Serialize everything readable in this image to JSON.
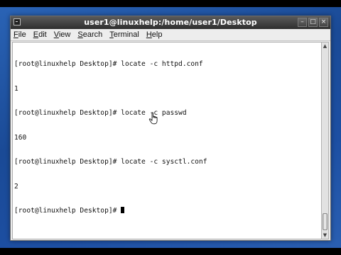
{
  "window": {
    "title": "user1@linuxhelp:/home/user1/Desktop",
    "buttons": {
      "minimize": "–",
      "maximize": "□",
      "close": "×"
    }
  },
  "menubar": {
    "items": [
      {
        "underline": "F",
        "rest": "ile"
      },
      {
        "underline": "E",
        "rest": "dit"
      },
      {
        "underline": "V",
        "rest": "iew"
      },
      {
        "underline": "S",
        "rest": "earch"
      },
      {
        "underline": "T",
        "rest": "erminal"
      },
      {
        "underline": "H",
        "rest": "elp"
      }
    ]
  },
  "terminal": {
    "lines": [
      "[root@linuxhelp Desktop]# locate -c httpd.conf",
      "1",
      "[root@linuxhelp Desktop]# locate -c passwd",
      "160",
      "[root@linuxhelp Desktop]# locate -c sysctl.conf",
      "2",
      "[root@linuxhelp Desktop]# "
    ]
  },
  "icons": {
    "window_icon": "terminal-icon",
    "pointer": "hand-pointer-icon"
  }
}
